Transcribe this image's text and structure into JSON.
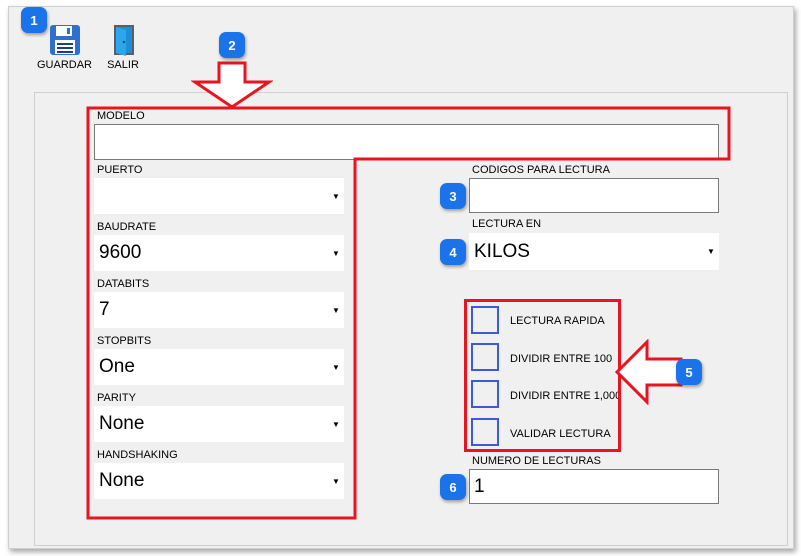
{
  "toolbar": {
    "save_label": "GUARDAR",
    "exit_label": "SALIR"
  },
  "form": {
    "modelo": {
      "label": "MODELO",
      "value": ""
    },
    "puerto": {
      "label": "PUERTO",
      "value": ""
    },
    "baudrate": {
      "label": "BAUDRATE",
      "value": "9600"
    },
    "databits": {
      "label": "DATABITS",
      "value": "7"
    },
    "stopbits": {
      "label": "STOPBITS",
      "value": "One"
    },
    "parity": {
      "label": "PARITY",
      "value": "None"
    },
    "handshaking": {
      "label": "HANDSHAKING",
      "value": "None"
    },
    "codigos": {
      "label": "CODIGOS PARA LECTURA",
      "value": ""
    },
    "lectura_en": {
      "label": "LECTURA EN",
      "value": "KILOS"
    },
    "checkboxes": [
      {
        "label": "LECTURA RAPIDA",
        "checked": false
      },
      {
        "label": "DIVIDIR ENTRE 100",
        "checked": false
      },
      {
        "label": "DIVIDIR ENTRE 1,000",
        "checked": false
      },
      {
        "label": "VALIDAR LECTURA",
        "checked": false
      }
    ],
    "numero_lecturas": {
      "label": "NUMERO DE LECTURAS",
      "value": "1"
    }
  },
  "annotations": {
    "badges": [
      "1",
      "2",
      "3",
      "4",
      "5",
      "6"
    ],
    "highlight_color": "#e8141f",
    "badge_color": "#1a73e8"
  }
}
